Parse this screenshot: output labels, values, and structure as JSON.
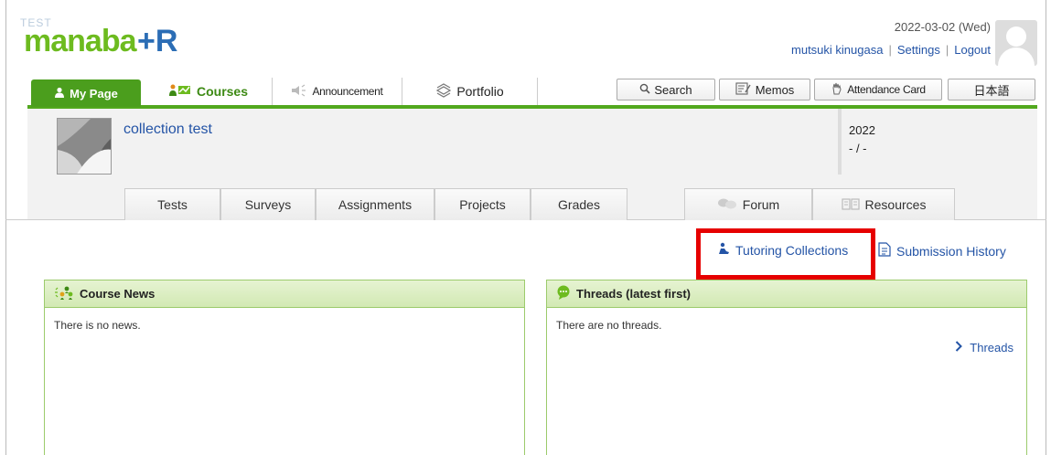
{
  "header": {
    "logo_prefix": "TEST",
    "logo_word": "manaba",
    "logo_suffix": "+R",
    "date": "2022-03-02 (Wed)",
    "user": "mutsuki kinugasa",
    "settings": "Settings",
    "logout": "Logout"
  },
  "nav": {
    "my_page": "My Page",
    "courses": "Courses",
    "announcement": "Announcement",
    "portfolio": "Portfolio",
    "search": "Search",
    "memos": "Memos",
    "attendance": "Attendance Card",
    "language": "日本語"
  },
  "course": {
    "title": "collection test",
    "year": "2022",
    "term": "- / -"
  },
  "subtabs": {
    "tests": "Tests",
    "surveys": "Surveys",
    "assignments": "Assignments",
    "projects": "Projects",
    "grades": "Grades",
    "forum": "Forum",
    "resources": "Resources"
  },
  "links": {
    "tutoring": "Tutoring Collections",
    "submission": "Submission History"
  },
  "news_panel": {
    "title": "Course News",
    "empty": "There is no news."
  },
  "threads_panel": {
    "title": "Threads (latest first)",
    "empty": "There are no threads.",
    "link": "Threads"
  },
  "colors": {
    "brand_green": "#6dbb1f",
    "nav_green": "#52a81e",
    "link_blue": "#2454a6",
    "highlight_red": "#e60000"
  }
}
